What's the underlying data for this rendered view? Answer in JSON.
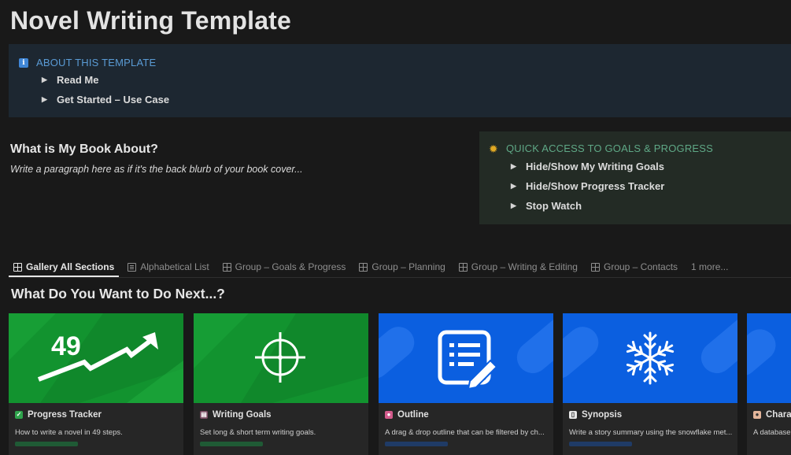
{
  "page": {
    "title": "Novel Writing Template"
  },
  "about": {
    "icon": "info-icon",
    "heading": "ABOUT THIS TEMPLATE",
    "toggles": [
      "Read Me",
      "Get Started – Use Case"
    ]
  },
  "book": {
    "heading": "What is My Book About?",
    "blurb": "Write a paragraph here as if it's the back blurb of your book cover..."
  },
  "quick": {
    "icon": "sun-icon",
    "heading": "QUICK ACCESS TO GOALS & PROGRESS",
    "toggles": [
      "Hide/Show My Writing Goals",
      "Hide/Show Progress Tracker",
      "Stop Watch"
    ]
  },
  "tabs": [
    {
      "label": "Gallery All Sections",
      "icon": "gallery-icon",
      "active": true
    },
    {
      "label": "Alphabetical List",
      "icon": "list-icon"
    },
    {
      "label": "Group – Goals & Progress",
      "icon": "board-icon"
    },
    {
      "label": "Group – Planning",
      "icon": "board-icon"
    },
    {
      "label": "Group – Writing & Editing",
      "icon": "board-icon"
    },
    {
      "label": "Group – Contacts",
      "icon": "board-icon"
    },
    {
      "label": "1 more..."
    }
  ],
  "section": {
    "heading": "What Do You Want to Do Next...?"
  },
  "cards": [
    {
      "title": "Progress Tracker",
      "icon": "check-icon",
      "desc": "How to write a novel in 49 steps.",
      "cover_text": "49",
      "cover_color": "#12932f",
      "tag_color": "#1f5a35"
    },
    {
      "title": "Writing Goals",
      "icon": "book-icon",
      "desc": "Set long & short term writing goals.",
      "cover_color": "#12932f",
      "tag_color": "#1f5a35"
    },
    {
      "title": "Outline",
      "icon": "brain-icon",
      "desc": "A drag & drop outline that can be filtered by ch...",
      "cover_color": "#0b5fe0",
      "tag_color": "#1f3b66"
    },
    {
      "title": "Synopsis",
      "icon": "page-icon",
      "desc": "Write a story summary using the snowflake met...",
      "cover_color": "#0b5fe0",
      "tag_color": "#1f3b66"
    },
    {
      "title": "Charac",
      "icon": "person-icon",
      "desc": "A database",
      "cover_color": "#0b5fe0",
      "tag_color": "#1f3b66"
    }
  ]
}
